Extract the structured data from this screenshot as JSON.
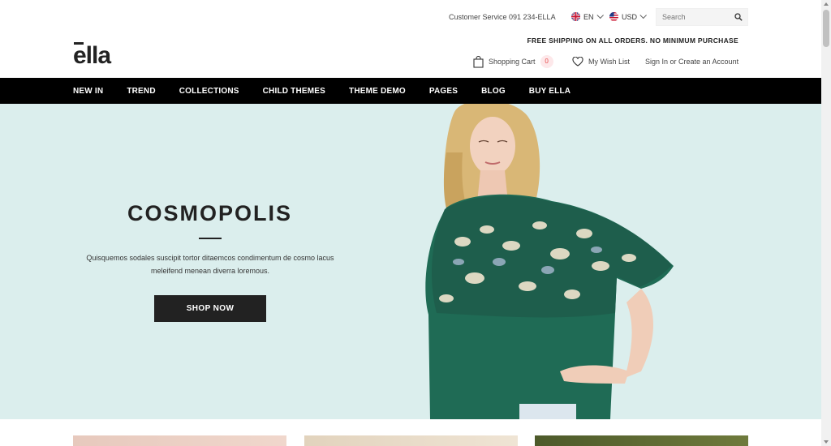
{
  "header": {
    "customer_service": "Customer Service 091 234-ELLA",
    "language": "EN",
    "currency": "USD",
    "search_placeholder": "Search",
    "shipping_notice": "FREE SHIPPING ON ALL ORDERS. NO MINIMUM PURCHASE",
    "logo": "ella",
    "cart_label": "Shopping Cart",
    "cart_count": "0",
    "wishlist_label": "My Wish List",
    "account_label": "Sign In or Create an Account"
  },
  "nav": {
    "items": [
      "NEW IN",
      "TREND",
      "COLLECTIONS",
      "CHILD THEMES",
      "THEME DEMO",
      "PAGES",
      "BLOG",
      "BUY ELLA"
    ]
  },
  "hero": {
    "title": "COSMOPOLIS",
    "text": "Quisquemos sodales suscipit tortor ditaemcos condimentum de cosmo lacus meleifend menean diverra loremous.",
    "button": "SHOP NOW",
    "background": "#dbeeed"
  },
  "colors": {
    "nav_bg": "#000000",
    "button_bg": "#222222",
    "badge_bg": "#fde8ea",
    "badge_text": "#e64a4a"
  }
}
